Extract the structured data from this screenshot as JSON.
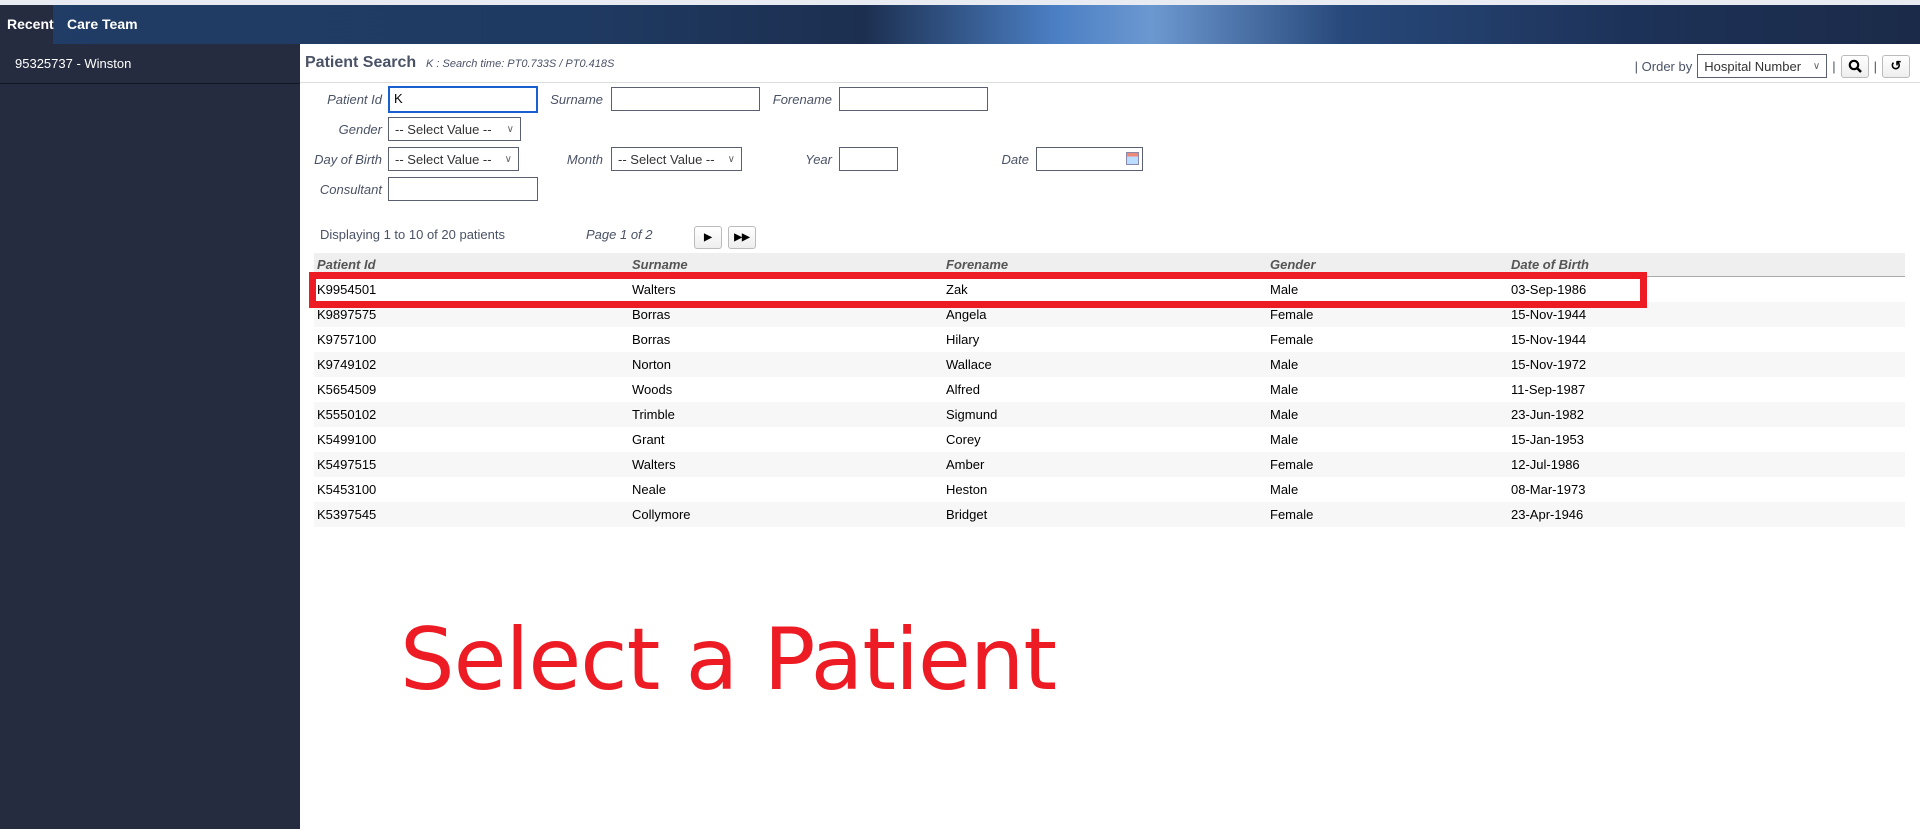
{
  "nav": {
    "tabs": [
      "Recent",
      "Care Team"
    ]
  },
  "sidebar": {
    "items": [
      {
        "label": "95325737 - Winston"
      }
    ]
  },
  "header": {
    "title": "Patient Search",
    "search_time": "K : Search time: PT0.733S / PT0.418S",
    "order_by_label": "| Order by",
    "order_by_value": "Hospital Number",
    "sep": "|"
  },
  "form": {
    "patient_id_label": "Patient Id",
    "patient_id_value": "K",
    "surname_label": "Surname",
    "forename_label": "Forename",
    "gender_label": "Gender",
    "gender_value": "-- Select Value --",
    "day_label": "Day of Birth",
    "day_value": "-- Select Value --",
    "month_label": "Month",
    "month_value": "-- Select Value --",
    "year_label": "Year",
    "date_label": "Date",
    "consultant_label": "Consultant"
  },
  "paging": {
    "displaying": "Displaying 1 to 10 of 20 patients",
    "page": "Page 1 of 2"
  },
  "table": {
    "headers": [
      "Patient Id",
      "Surname",
      "Forename",
      "Gender",
      "Date of Birth"
    ],
    "rows": [
      [
        "K9954501",
        "Walters",
        "Zak",
        "Male",
        "03-Sep-1986"
      ],
      [
        "K9897575",
        "Borras",
        "Angela",
        "Female",
        "15-Nov-1944"
      ],
      [
        "K9757100",
        "Borras",
        "Hilary",
        "Female",
        "15-Nov-1944"
      ],
      [
        "K9749102",
        "Norton",
        "Wallace",
        "Male",
        "15-Nov-1972"
      ],
      [
        "K5654509",
        "Woods",
        "Alfred",
        "Male",
        "11-Sep-1987"
      ],
      [
        "K5550102",
        "Trimble",
        "Sigmund",
        "Male",
        "23-Jun-1982"
      ],
      [
        "K5499100",
        "Grant",
        "Corey",
        "Male",
        "15-Jan-1953"
      ],
      [
        "K5497515",
        "Walters",
        "Amber",
        "Female",
        "12-Jul-1986"
      ],
      [
        "K5453100",
        "Neale",
        "Heston",
        "Male",
        "08-Mar-1973"
      ],
      [
        "K5397545",
        "Collymore",
        "Bridget",
        "Female",
        "23-Apr-1946"
      ]
    ]
  },
  "annotation": {
    "text": "Select a Patient",
    "color": "#ed1c24"
  }
}
